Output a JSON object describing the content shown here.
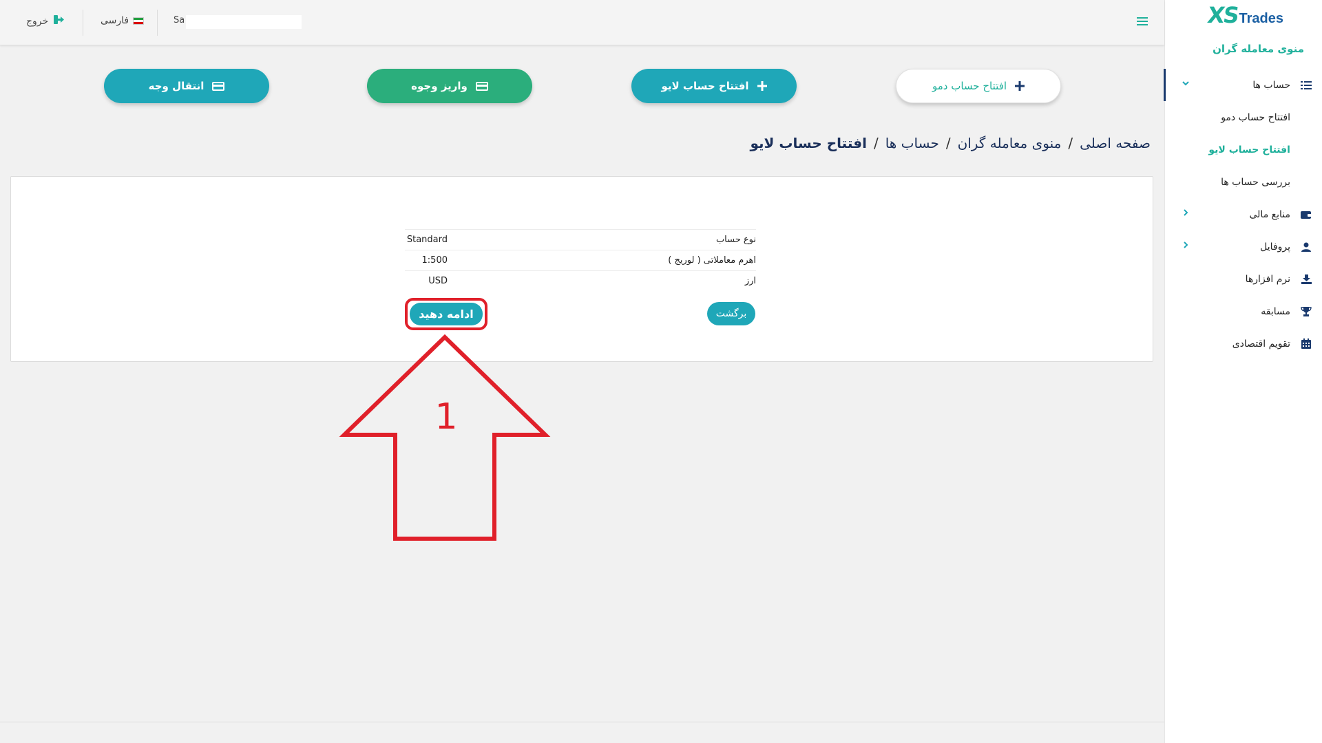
{
  "brand": {
    "logo_mark": "XS",
    "logo_name": "Trades",
    "accent": "#1fb09b",
    "primary": "#1fa7b8",
    "deposit": "#2bae7c",
    "navy": "#1a3a6e"
  },
  "sidebar": {
    "title": "منوی معامله گران",
    "items": [
      {
        "label": "حساب ها",
        "icon": "list-icon"
      },
      {
        "label": "افتتاح حساب دمو"
      },
      {
        "label": "افتتاح حساب لایو"
      },
      {
        "label": "بررسی حساب ها"
      },
      {
        "label": "منابع مالی",
        "icon": "wallet-icon"
      },
      {
        "label": "پروفایل",
        "icon": "user-icon"
      },
      {
        "label": "نرم افزارها",
        "icon": "download-icon"
      },
      {
        "label": "مسابقه",
        "icon": "trophy-icon"
      },
      {
        "label": "تقویم اقتصادی",
        "icon": "calendar-icon"
      }
    ]
  },
  "topbar": {
    "logout_label": "خروج",
    "language_label": "فارسی",
    "user_prefix": "Sa"
  },
  "actions": {
    "demo_label": "افتتاح حساب دمو",
    "live_label": "افتتاح حساب لایو",
    "deposit_label": "واریز وجوه",
    "transfer_label": "انتقال وجه"
  },
  "breadcrumb": {
    "items": [
      "صفحه اصلی",
      "منوی معامله گران",
      "حساب ها"
    ],
    "current": "افتتاح حساب لایو",
    "separator": "/"
  },
  "account_summary": {
    "rows": [
      {
        "label": "نوع حساب",
        "value": "Standard"
      },
      {
        "label": "اهرم معاملاتی ( لوریج )",
        "value": "1:500"
      },
      {
        "label": "ارز",
        "value": "USD"
      }
    ],
    "back_label": "برگشت",
    "continue_label": "ادامه دهید"
  },
  "annotation": {
    "step_number": "1",
    "color": "#e0202a"
  }
}
